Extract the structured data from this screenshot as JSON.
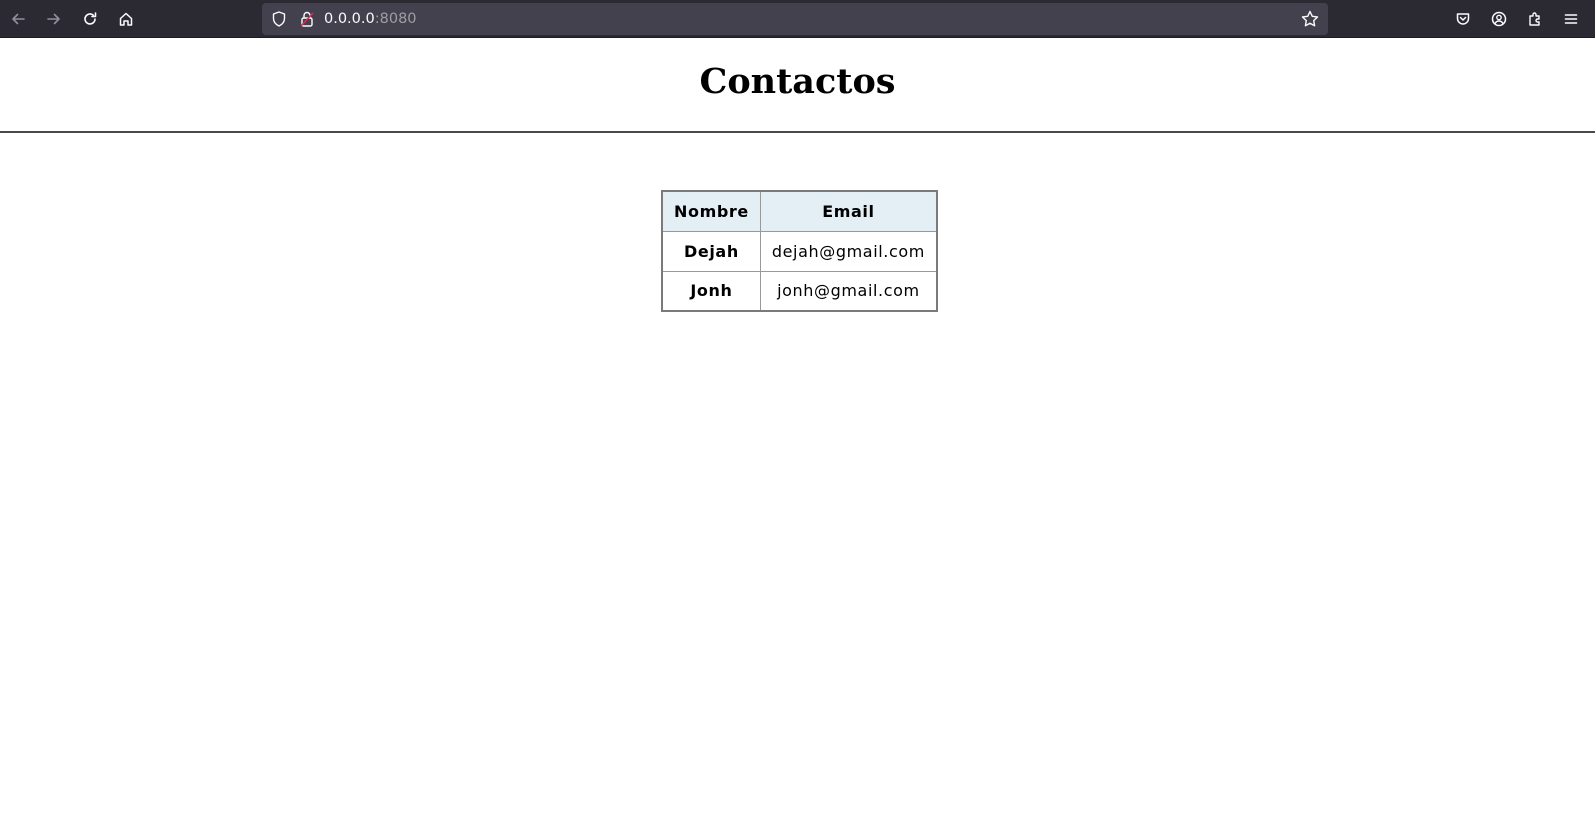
{
  "browser": {
    "url_host": "0.0.0.0",
    "url_port": ":8080",
    "icons": [
      "back-arrow-icon",
      "forward-arrow-icon",
      "reload-icon",
      "home-icon",
      "shield-icon",
      "insecure-lock-icon",
      "bookmark-star-icon",
      "pocket-icon",
      "account-icon",
      "extensions-icon",
      "menu-icon"
    ]
  },
  "page": {
    "title": "Contactos"
  },
  "table": {
    "headers": [
      "Nombre",
      "Email"
    ],
    "rows": [
      {
        "name": "Dejah",
        "email": "dejah@gmail.com"
      },
      {
        "name": "Jonh",
        "email": "jonh@gmail.com"
      }
    ]
  },
  "colors": {
    "toolbar_bg": "#2b2a33",
    "urlbar_bg": "#42414d",
    "table_header_bg": "#e4eef5"
  }
}
